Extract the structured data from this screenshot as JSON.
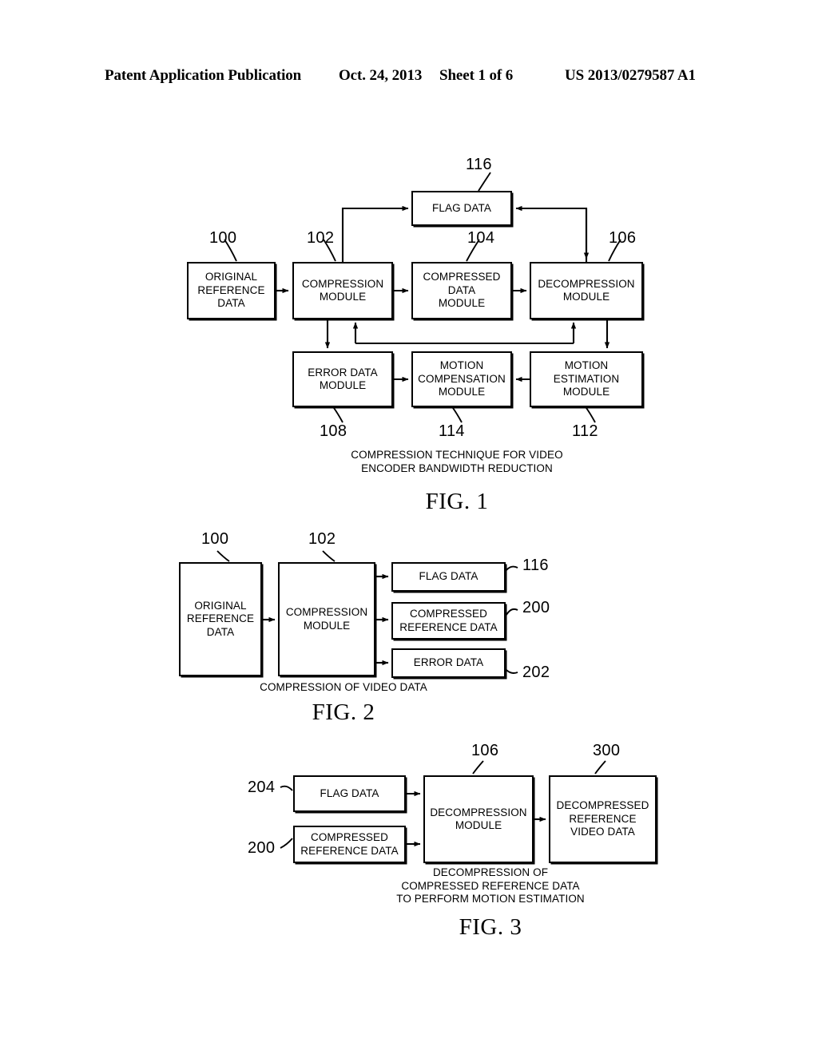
{
  "header": {
    "left": "Patent Application Publication",
    "date": "Oct. 24, 2013",
    "sheet": "Sheet 1 of 6",
    "pubnum": "US 2013/0279587 A1"
  },
  "figures": [
    {
      "id": "fig1",
      "label": "FIG. 1",
      "caption": "COMPRESSION TECHNIQUE FOR VIDEO\nENCODER BANDWIDTH REDUCTION",
      "blocks": [
        {
          "key": "flag_data",
          "text": "FLAG DATA",
          "ref": "116"
        },
        {
          "key": "original_reference",
          "text": "ORIGINAL\nREFERENCE\nDATA",
          "ref": "100"
        },
        {
          "key": "compression_module",
          "text": "COMPRESSION\nMODULE",
          "ref": "102"
        },
        {
          "key": "compressed_data",
          "text": "COMPRESSED\nDATA\nMODULE",
          "ref": "104"
        },
        {
          "key": "decompression_module",
          "text": "DECOMPRESSION\nMODULE",
          "ref": "106"
        },
        {
          "key": "error_data_module",
          "text": "ERROR DATA\nMODULE",
          "ref": "108"
        },
        {
          "key": "motion_compensation",
          "text": "MOTION\nCOMPENSATION\nMODULE",
          "ref": "114"
        },
        {
          "key": "motion_estimation",
          "text": "MOTION\nESTIMATION\nMODULE",
          "ref": "112"
        }
      ]
    },
    {
      "id": "fig2",
      "label": "FIG. 2",
      "caption": "COMPRESSION OF VIDEO DATA",
      "blocks": [
        {
          "key": "original_reference",
          "text": "ORIGINAL\nREFERENCE\nDATA",
          "ref": "100"
        },
        {
          "key": "compression_module",
          "text": "COMPRESSION\nMODULE",
          "ref": "102"
        },
        {
          "key": "flag_data",
          "text": "FLAG DATA",
          "ref": "116"
        },
        {
          "key": "compressed_reference",
          "text": "COMPRESSED\nREFERENCE DATA",
          "ref": "200"
        },
        {
          "key": "error_data",
          "text": "ERROR DATA",
          "ref": "202"
        }
      ]
    },
    {
      "id": "fig3",
      "label": "FIG. 3",
      "caption": "DECOMPRESSION OF\nCOMPRESSED REFERENCE DATA\nTO PERFORM MOTION ESTIMATION",
      "blocks": [
        {
          "key": "flag_data",
          "text": "FLAG DATA",
          "ref": "204"
        },
        {
          "key": "compressed_reference",
          "text": "COMPRESSED\nREFERENCE DATA",
          "ref": "200"
        },
        {
          "key": "decompression_module",
          "text": "DECOMPRESSION\nMODULE",
          "ref": "106"
        },
        {
          "key": "decompressed_reference",
          "text": "DECOMPRESSED\nREFERENCE\nVIDEO DATA",
          "ref": "300"
        }
      ]
    }
  ],
  "colors": {
    "ink": "#000000",
    "paper": "#ffffff"
  }
}
